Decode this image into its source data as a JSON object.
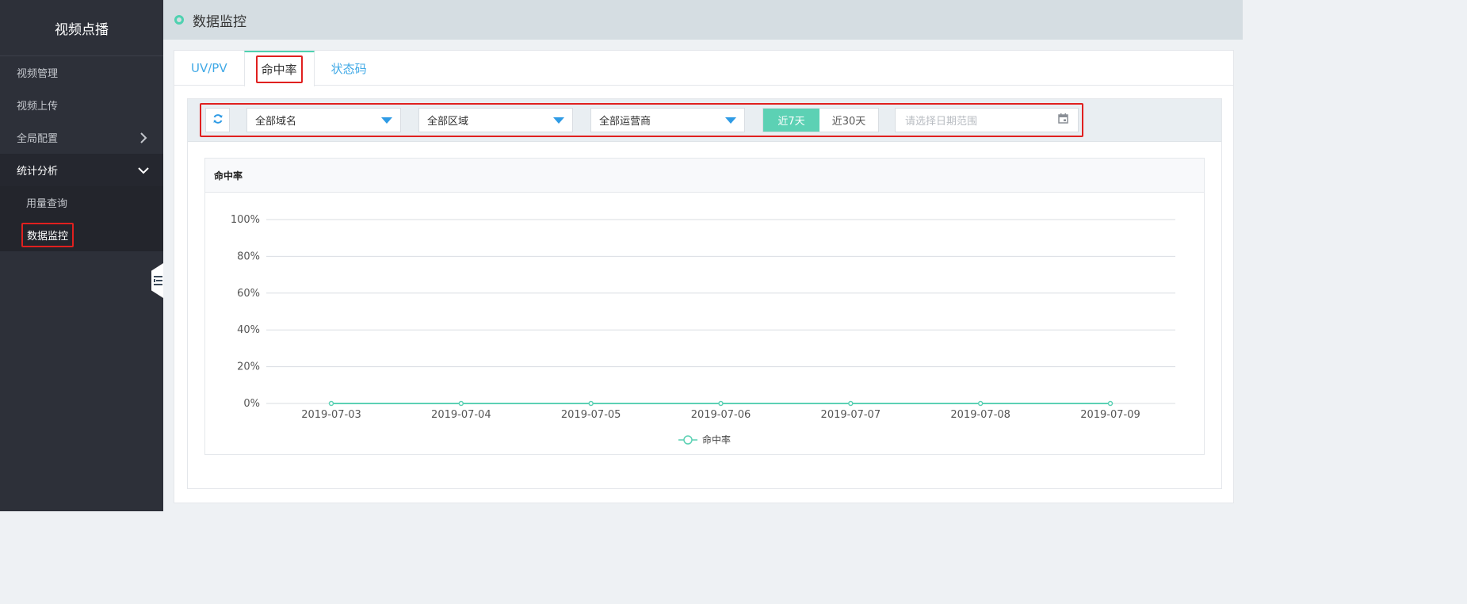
{
  "sidebar": {
    "brand": "视频点播",
    "items": [
      {
        "label": "视频管理"
      },
      {
        "label": "视频上传"
      },
      {
        "label": "全局配置",
        "icon": "chevron-right-icon"
      },
      {
        "label": "统计分析",
        "icon": "chevron-down-icon"
      }
    ],
    "sub_items": [
      {
        "label": "用量查询"
      },
      {
        "label": "数据监控",
        "active": true
      }
    ],
    "collapse_icon": "collapse-menu-icon"
  },
  "header": {
    "title": "数据监控"
  },
  "tabs": [
    {
      "label": "UV/PV"
    },
    {
      "label": "命中率",
      "active": true
    },
    {
      "label": "状态码"
    }
  ],
  "filters": {
    "refresh_icon": "refresh-icon",
    "domain": "全部域名",
    "region": "全部区域",
    "isp": "全部运营商",
    "range_7": "近7天",
    "range_30": "近30天",
    "date_placeholder": "请选择日期范围",
    "calendar_icon": "calendar-icon"
  },
  "colors": {
    "accent": "#5cd1b4",
    "link": "#40a9e6",
    "highlight": "#e0201f",
    "sidebar": "#2d3039"
  },
  "chart_data": {
    "type": "line",
    "title": "命中率",
    "categories": [
      "2019-07-03",
      "2019-07-04",
      "2019-07-05",
      "2019-07-06",
      "2019-07-07",
      "2019-07-08",
      "2019-07-09"
    ],
    "series": [
      {
        "name": "命中率",
        "values": [
          0,
          0,
          0,
          0,
          0,
          0,
          0
        ],
        "color": "#5cd1b4"
      }
    ],
    "yticks": [
      "100%",
      "80%",
      "60%",
      "40%",
      "20%",
      "0%"
    ],
    "ylim": [
      0,
      100
    ],
    "grid": true,
    "legend": "bottom-center"
  }
}
